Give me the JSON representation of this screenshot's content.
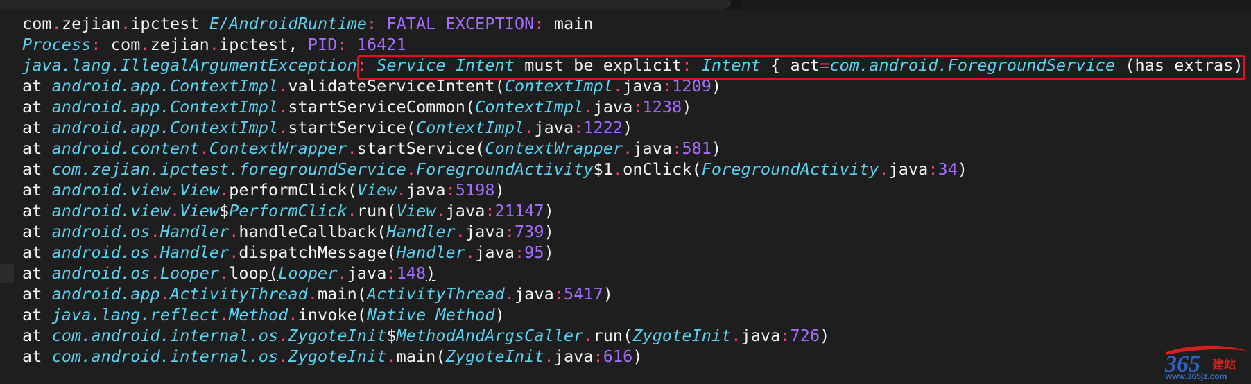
{
  "colors": {
    "background": "#1e1e1e",
    "text": "#f2f2f2",
    "keyword": "#ff3d7f",
    "class": "#5ad1f0",
    "purple": "#a56cff",
    "highlight_box": "#e0101e"
  },
  "logcat": [
    [
      [
        "w",
        "com"
      ],
      [
        "k",
        "."
      ],
      [
        "w",
        "zejian"
      ],
      [
        "k",
        "."
      ],
      [
        "w",
        "ipctest "
      ],
      [
        "c",
        "E/AndroidRuntime"
      ],
      [
        "k",
        ":"
      ],
      [
        "w",
        " "
      ],
      [
        "p",
        "FATAL EXCEPTION"
      ],
      [
        "k",
        ":"
      ],
      [
        "w",
        " main"
      ]
    ],
    [
      [
        "c",
        "Process"
      ],
      [
        "k",
        ":"
      ],
      [
        "w",
        " com"
      ],
      [
        "k",
        "."
      ],
      [
        "w",
        "zejian"
      ],
      [
        "k",
        "."
      ],
      [
        "w",
        "ipctest, "
      ],
      [
        "p",
        "PID"
      ],
      [
        "k",
        ":"
      ],
      [
        "w",
        " "
      ],
      [
        "p",
        "16421"
      ]
    ],
    [
      [
        "c",
        "java.lang.IllegalArgumentException"
      ],
      [
        "k",
        ":"
      ],
      [
        "w",
        " "
      ],
      [
        "c",
        "Service Intent"
      ],
      [
        "w",
        " must be explicit"
      ],
      [
        "k",
        ":"
      ],
      [
        "w",
        " "
      ],
      [
        "c",
        "Intent"
      ],
      [
        "w",
        " { act"
      ],
      [
        "k",
        "="
      ],
      [
        "c",
        "com.android.ForegroundService"
      ],
      [
        "w",
        " (has extras) }"
      ]
    ],
    [
      [
        "w",
        "at "
      ],
      [
        "c",
        "android.app.ContextImpl"
      ],
      [
        "k",
        "."
      ],
      [
        "w",
        "validateServiceIntent("
      ],
      [
        "c",
        "ContextImpl"
      ],
      [
        "k",
        "."
      ],
      [
        "w",
        "java"
      ],
      [
        "k",
        ":"
      ],
      [
        "p",
        "1209"
      ],
      [
        "w",
        ")"
      ]
    ],
    [
      [
        "w",
        "at "
      ],
      [
        "c",
        "android.app.ContextImpl"
      ],
      [
        "k",
        "."
      ],
      [
        "w",
        "startServiceCommon("
      ],
      [
        "c",
        "ContextImpl"
      ],
      [
        "k",
        "."
      ],
      [
        "w",
        "java"
      ],
      [
        "k",
        ":"
      ],
      [
        "p",
        "1238"
      ],
      [
        "w",
        ")"
      ]
    ],
    [
      [
        "w",
        "at "
      ],
      [
        "c",
        "android.app.ContextImpl"
      ],
      [
        "k",
        "."
      ],
      [
        "w",
        "startService("
      ],
      [
        "c",
        "ContextImpl"
      ],
      [
        "k",
        "."
      ],
      [
        "w",
        "java"
      ],
      [
        "k",
        ":"
      ],
      [
        "p",
        "1222"
      ],
      [
        "w",
        ")"
      ]
    ],
    [
      [
        "w",
        "at "
      ],
      [
        "c",
        "android.content"
      ],
      [
        "k",
        "."
      ],
      [
        "c",
        "ContextWrapper"
      ],
      [
        "k",
        "."
      ],
      [
        "w",
        "startService("
      ],
      [
        "c",
        "ContextWrapper"
      ],
      [
        "k",
        "."
      ],
      [
        "w",
        "java"
      ],
      [
        "k",
        ":"
      ],
      [
        "p",
        "581"
      ],
      [
        "w",
        ")"
      ]
    ],
    [
      [
        "w",
        "at "
      ],
      [
        "c",
        "com.zejian.ipctest.foregroundService"
      ],
      [
        "k",
        "."
      ],
      [
        "c",
        "ForegroundActivity"
      ],
      [
        "w",
        "$1"
      ],
      [
        "k",
        "."
      ],
      [
        "w",
        "onClick("
      ],
      [
        "c",
        "ForegroundActivity"
      ],
      [
        "k",
        "."
      ],
      [
        "w",
        "java"
      ],
      [
        "k",
        ":"
      ],
      [
        "p",
        "34"
      ],
      [
        "w",
        ")"
      ]
    ],
    [
      [
        "w",
        "at "
      ],
      [
        "c",
        "android.view"
      ],
      [
        "k",
        "."
      ],
      [
        "c",
        "View"
      ],
      [
        "k",
        "."
      ],
      [
        "w",
        "performClick("
      ],
      [
        "c",
        "View"
      ],
      [
        "k",
        "."
      ],
      [
        "w",
        "java"
      ],
      [
        "k",
        ":"
      ],
      [
        "p",
        "5198"
      ],
      [
        "w",
        ")"
      ]
    ],
    [
      [
        "w",
        "at "
      ],
      [
        "c",
        "android.view"
      ],
      [
        "k",
        "."
      ],
      [
        "c",
        "View"
      ],
      [
        "w",
        "$"
      ],
      [
        "c",
        "PerformClick"
      ],
      [
        "k",
        "."
      ],
      [
        "w",
        "run("
      ],
      [
        "c",
        "View"
      ],
      [
        "k",
        "."
      ],
      [
        "w",
        "java"
      ],
      [
        "k",
        ":"
      ],
      [
        "p",
        "21147"
      ],
      [
        "w",
        ")"
      ]
    ],
    [
      [
        "w",
        "at "
      ],
      [
        "c",
        "android.os"
      ],
      [
        "k",
        "."
      ],
      [
        "c",
        "Handler"
      ],
      [
        "k",
        "."
      ],
      [
        "w",
        "handleCallback("
      ],
      [
        "c",
        "Handler"
      ],
      [
        "k",
        "."
      ],
      [
        "w",
        "java"
      ],
      [
        "k",
        ":"
      ],
      [
        "p",
        "739"
      ],
      [
        "w",
        ")"
      ]
    ],
    [
      [
        "w",
        "at "
      ],
      [
        "c",
        "android.os"
      ],
      [
        "k",
        "."
      ],
      [
        "c",
        "Handler"
      ],
      [
        "k",
        "."
      ],
      [
        "w",
        "dispatchMessage("
      ],
      [
        "c",
        "Handler"
      ],
      [
        "k",
        "."
      ],
      [
        "w",
        "java"
      ],
      [
        "k",
        ":"
      ],
      [
        "p",
        "95"
      ],
      [
        "w",
        ")"
      ]
    ],
    [
      [
        "w",
        "at "
      ],
      [
        "c",
        "android.os"
      ],
      [
        "k",
        "."
      ],
      [
        "c",
        "Looper"
      ],
      [
        "k",
        "."
      ],
      [
        "w",
        "loop"
      ],
      [
        "u",
        "("
      ],
      [
        "c",
        "Looper"
      ],
      [
        "k",
        "."
      ],
      [
        "w",
        "java"
      ],
      [
        "k",
        ":"
      ],
      [
        "p",
        "148"
      ],
      [
        "u",
        ")"
      ]
    ],
    [
      [
        "w",
        "at "
      ],
      [
        "c",
        "android.app"
      ],
      [
        "k",
        "."
      ],
      [
        "c",
        "ActivityThread"
      ],
      [
        "k",
        "."
      ],
      [
        "w",
        "main("
      ],
      [
        "c",
        "ActivityThread"
      ],
      [
        "k",
        "."
      ],
      [
        "w",
        "java"
      ],
      [
        "k",
        ":"
      ],
      [
        "p",
        "5417"
      ],
      [
        "w",
        ")"
      ]
    ],
    [
      [
        "w",
        "at "
      ],
      [
        "c",
        "java.lang.reflect"
      ],
      [
        "k",
        "."
      ],
      [
        "c",
        "Method"
      ],
      [
        "k",
        "."
      ],
      [
        "w",
        "invoke("
      ],
      [
        "c",
        "Native Method"
      ],
      [
        "w",
        ")"
      ]
    ],
    [
      [
        "w",
        "at "
      ],
      [
        "c",
        "com.android.internal.os"
      ],
      [
        "k",
        "."
      ],
      [
        "c",
        "ZygoteInit"
      ],
      [
        "w",
        "$"
      ],
      [
        "c",
        "MethodAndArgsCaller"
      ],
      [
        "k",
        "."
      ],
      [
        "w",
        "run("
      ],
      [
        "c",
        "ZygoteInit"
      ],
      [
        "k",
        "."
      ],
      [
        "w",
        "java"
      ],
      [
        "k",
        ":"
      ],
      [
        "p",
        "726"
      ],
      [
        "w",
        ")"
      ]
    ],
    [
      [
        "w",
        "at "
      ],
      [
        "c",
        "com.android.internal.os"
      ],
      [
        "k",
        "."
      ],
      [
        "c",
        "ZygoteInit"
      ],
      [
        "k",
        "."
      ],
      [
        "w",
        "main("
      ],
      [
        "c",
        "ZygoteInit"
      ],
      [
        "k",
        "."
      ],
      [
        "w",
        "java"
      ],
      [
        "k",
        ":"
      ],
      [
        "p",
        "616"
      ],
      [
        "w",
        ")"
      ]
    ]
  ],
  "watermark": {
    "logo_text": "365",
    "logo_suffix": "建站",
    "url": "www.365jz.com"
  }
}
